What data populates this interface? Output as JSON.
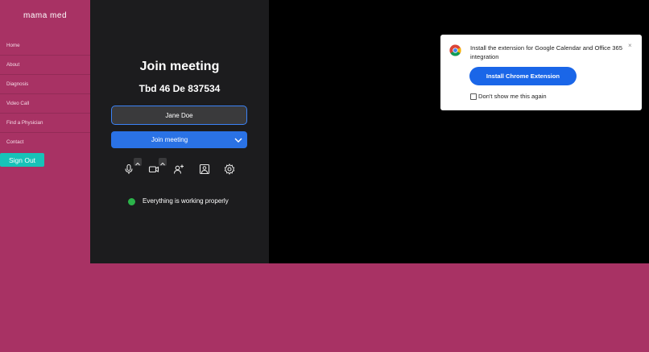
{
  "sidebar": {
    "brand": "mama med",
    "items": [
      {
        "label": "Home"
      },
      {
        "label": "About"
      },
      {
        "label": "Diagnosis"
      },
      {
        "label": "Video Call"
      },
      {
        "label": "Find a Physician"
      },
      {
        "label": "Contact"
      }
    ],
    "sign_out_label": "Sign Out"
  },
  "join": {
    "title": "Join meeting",
    "meeting_id": "Tbd 46 De 837534",
    "name_value": "Jane Doe",
    "button_label": "Join meeting",
    "status_text": "Everything is working properly",
    "controls": [
      "microphone-icon",
      "camera-icon",
      "add-person-icon",
      "background-image-icon",
      "gear-icon"
    ]
  },
  "popup": {
    "message": "Install the extension for Google Calendar and Office 365 integration",
    "install_label": "Install Chrome Extension",
    "dont_show_label": "Don't show me this again",
    "close_glyph": "×"
  },
  "colors": {
    "brand_pink": "#a83264",
    "sign_out_teal": "#17c3b8",
    "join_blue": "#2a72e5",
    "install_blue": "#1a66e8",
    "status_green": "#2bb34a"
  }
}
